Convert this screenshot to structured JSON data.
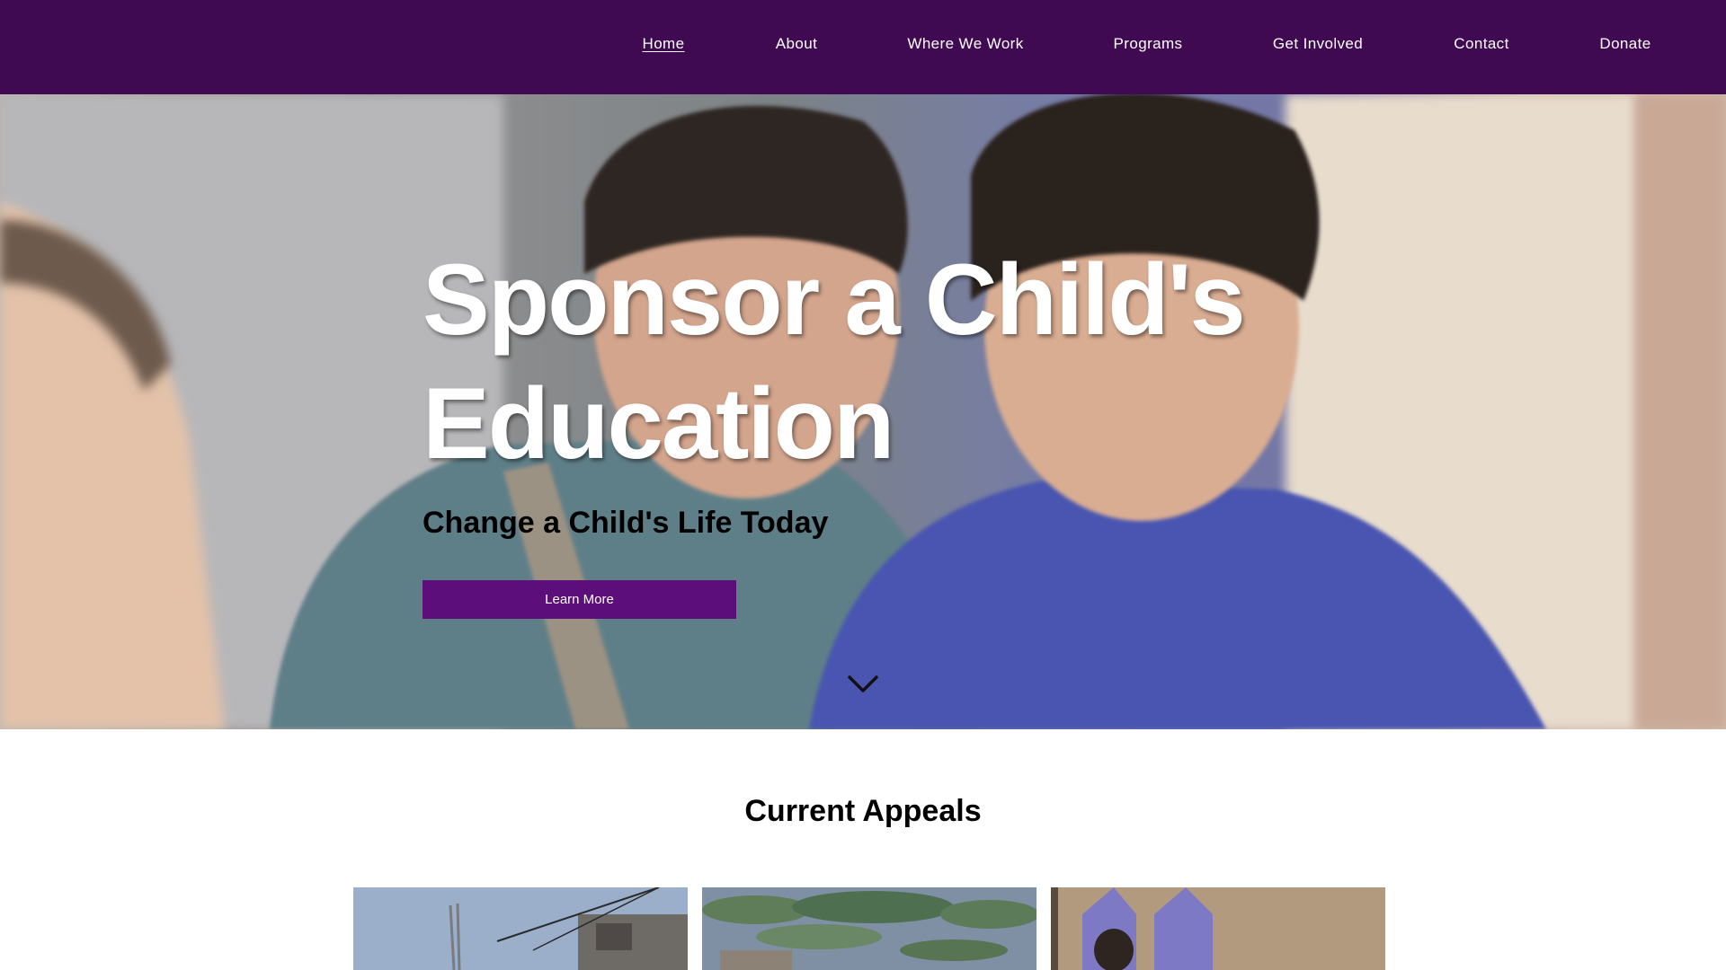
{
  "nav": {
    "items": [
      {
        "label": "Home",
        "active": true
      },
      {
        "label": "About",
        "active": false
      },
      {
        "label": "Where We Work",
        "active": false
      },
      {
        "label": "Programs",
        "active": false
      },
      {
        "label": "Get Involved",
        "active": false
      },
      {
        "label": "Contact",
        "active": false
      },
      {
        "label": "Donate",
        "active": false
      }
    ]
  },
  "hero": {
    "title": "Sponsor a Child's Education",
    "subtitle": "Change a Child's Life Today",
    "button_label": "Learn More",
    "scroll_icon": "chevron-down-icon"
  },
  "appeals": {
    "title": "Current Appeals"
  },
  "colors": {
    "nav_bg": "#3f0a52",
    "button_bg": "#5c0f7a",
    "text_light": "#ffffff"
  }
}
